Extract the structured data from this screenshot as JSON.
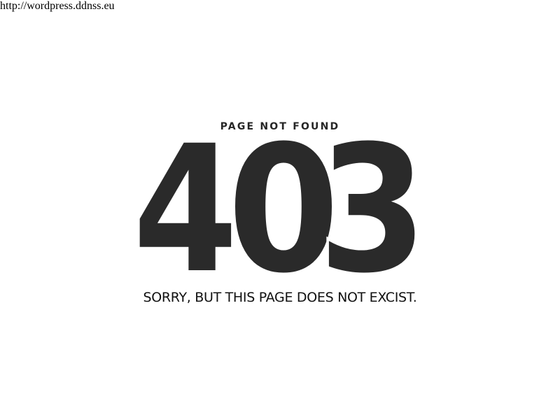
{
  "address": {
    "url": "http://wordpress.ddnss.eu"
  },
  "error": {
    "heading": "PAGE NOT FOUND",
    "code_digits": [
      "4",
      "0",
      "3"
    ],
    "message": "SORRY, BUT THIS PAGE DOES NOT EXCIST."
  },
  "colors": {
    "text_dark": "#262626",
    "background": "#ffffff"
  }
}
